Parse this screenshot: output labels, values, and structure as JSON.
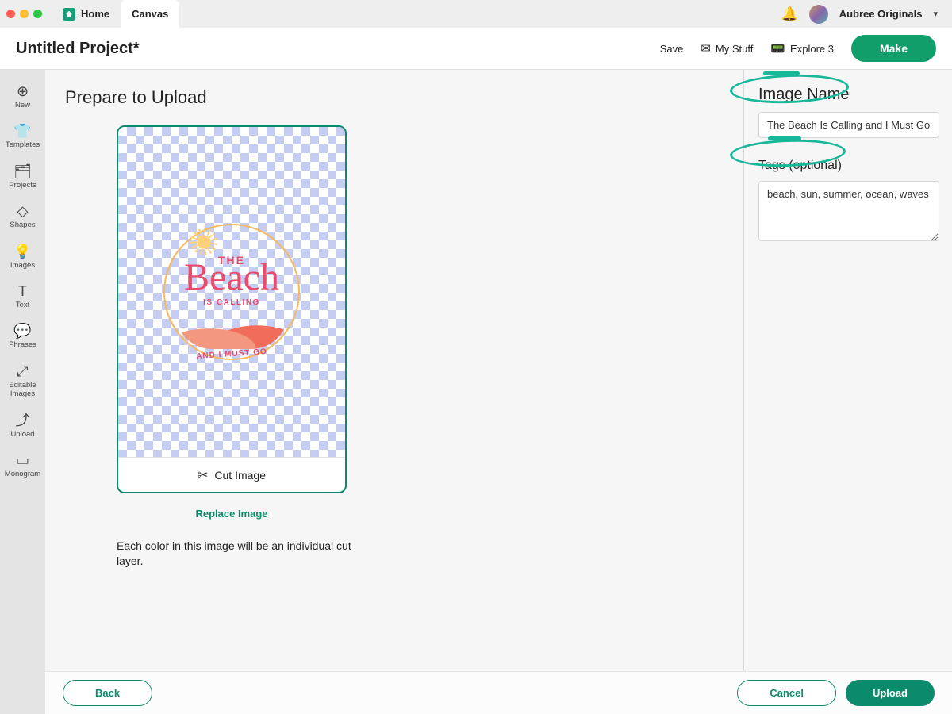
{
  "tabs": {
    "home": "Home",
    "canvas": "Canvas"
  },
  "user": {
    "name": "Aubree Originals"
  },
  "project": {
    "title": "Untitled Project*"
  },
  "header": {
    "save": "Save",
    "mystuff": "My Stuff",
    "machine": "Explore 3",
    "make": "Make"
  },
  "sidebar": {
    "items": [
      {
        "icon": "⊕",
        "label": "New"
      },
      {
        "icon": "👕",
        "label": "Templates"
      },
      {
        "icon": "🗂",
        "label": "Projects"
      },
      {
        "icon": "◇",
        "label": "Shapes"
      },
      {
        "icon": "💡",
        "label": "Images"
      },
      {
        "icon": "T",
        "label": "Text"
      },
      {
        "icon": "💬",
        "label": "Phrases"
      },
      {
        "icon": "⤢",
        "label": "Editable\nImages"
      },
      {
        "icon": "⤴",
        "label": "Upload"
      },
      {
        "icon": "▭",
        "label": "Monogram"
      }
    ]
  },
  "upload": {
    "heading": "Prepare to Upload",
    "cut_image": "Cut Image",
    "replace": "Replace Image",
    "hint": "Each color in this image will be an individual cut layer.",
    "art": {
      "the": "THE",
      "beach": "Beach",
      "calling": "IS CALLING",
      "must": "AND I MUST GO"
    }
  },
  "form": {
    "name_label": "Image Name",
    "name_value": "The Beach Is Calling and I Must Go",
    "tags_label": "Tags (optional)",
    "tags_value": "beach, sun, summer, ocean, waves"
  },
  "footer": {
    "back": "Back",
    "cancel": "Cancel",
    "upload": "Upload"
  }
}
